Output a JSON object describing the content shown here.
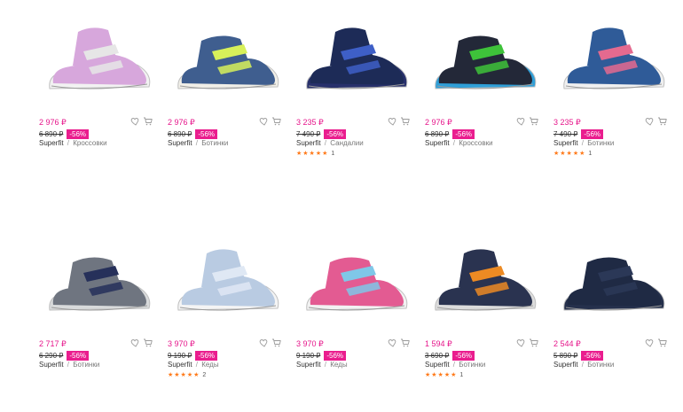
{
  "products": [
    {
      "price": "2 976 ₽",
      "old_price": "6 890 ₽",
      "discount": "-56%",
      "brand": "Superfit",
      "separator": "/",
      "category": "Кроссовки",
      "stars": "",
      "rating_count": "",
      "colors": {
        "upper": "#d7a7dc",
        "accent": "#e6e6e6",
        "sole": "#f2f2f2"
      }
    },
    {
      "price": "2 976 ₽",
      "old_price": "6 890 ₽",
      "discount": "-56%",
      "brand": "Superfit",
      "separator": "/",
      "category": "Ботинки",
      "stars": "",
      "rating_count": "",
      "colors": {
        "upper": "#3f5e8f",
        "accent": "#d7f05a",
        "sole": "#f1efe8"
      }
    },
    {
      "price": "3 235 ₽",
      "old_price": "7 490 ₽",
      "discount": "-56%",
      "brand": "Superfit",
      "separator": "/",
      "category": "Сандалии",
      "stars": "★★★★★",
      "rating_count": "1",
      "colors": {
        "upper": "#1d2b57",
        "accent": "#3e5fc7",
        "sole": "#27306b"
      }
    },
    {
      "price": "2 976 ₽",
      "old_price": "6 890 ₽",
      "discount": "-56%",
      "brand": "Superfit",
      "separator": "/",
      "category": "Кроссовки",
      "stars": "",
      "rating_count": "",
      "colors": {
        "upper": "#232838",
        "accent": "#3ec23a",
        "sole": "#2f9fd8"
      }
    },
    {
      "price": "3 235 ₽",
      "old_price": "7 490 ₽",
      "discount": "-56%",
      "brand": "Superfit",
      "separator": "/",
      "category": "Ботинки",
      "stars": "★★★★★",
      "rating_count": "1",
      "colors": {
        "upper": "#2f5b98",
        "accent": "#e46a8f",
        "sole": "#f0f0f0"
      }
    },
    {
      "price": "2 717 ₽",
      "old_price": "6 290 ₽",
      "discount": "-56%",
      "brand": "Superfit",
      "separator": "/",
      "category": "Ботинки",
      "stars": "",
      "rating_count": "",
      "colors": {
        "upper": "#6f7580",
        "accent": "#26305a",
        "sole": "#d8dadb"
      }
    },
    {
      "price": "3 970 ₽",
      "old_price": "9 190 ₽",
      "discount": "-56%",
      "brand": "Superfit",
      "separator": "/",
      "category": "Кеды",
      "stars": "★★★★★",
      "rating_count": "2",
      "colors": {
        "upper": "#b9cbe2",
        "accent": "#dfe8f4",
        "sole": "#f4f4f4"
      }
    },
    {
      "price": "3 970 ₽",
      "old_price": "9 190 ₽",
      "discount": "-56%",
      "brand": "Superfit",
      "separator": "/",
      "category": "Кеды",
      "stars": "",
      "rating_count": "",
      "colors": {
        "upper": "#e35b92",
        "accent": "#7fc7e8",
        "sole": "#f2f2f2"
      }
    },
    {
      "price": "1 594 ₽",
      "old_price": "3 690 ₽",
      "discount": "-56%",
      "brand": "Superfit",
      "separator": "/",
      "category": "Ботинки",
      "stars": "★★★★★",
      "rating_count": "1",
      "colors": {
        "upper": "#2a3350",
        "accent": "#ec8a23",
        "sole": "#dcdcdc"
      }
    },
    {
      "price": "2 544 ₽",
      "old_price": "5 890 ₽",
      "discount": "-56%",
      "brand": "Superfit",
      "separator": "/",
      "category": "Ботинки",
      "stars": "",
      "rating_count": "",
      "colors": {
        "upper": "#1f2a44",
        "accent": "#2b3857",
        "sole": "#25304c"
      }
    }
  ],
  "ui": {
    "wishlist_icon": "heart-icon",
    "cart_icon": "cart-icon",
    "accent_color": "#ea1d8e",
    "star_color": "#ff7a1a"
  }
}
